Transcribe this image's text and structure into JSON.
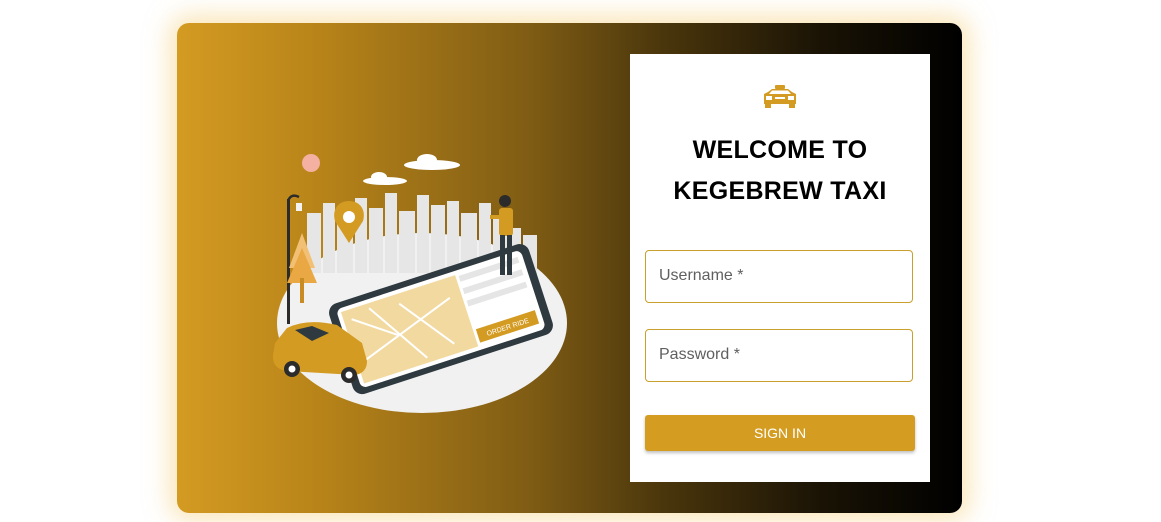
{
  "brand": {
    "title_line1": "WELCOME TO",
    "title_line2": "KEGEBREW TAXI",
    "logo_icon": "taxi-car-icon"
  },
  "illustration": {
    "button_text": "ORDER RIDE"
  },
  "form": {
    "username_label": "Username",
    "password_label": "Password",
    "required_marker": "*",
    "signin_label": "SIGN IN"
  },
  "colors": {
    "accent": "#d49d22",
    "gradient_start": "#d49b22",
    "gradient_end": "#000000"
  }
}
